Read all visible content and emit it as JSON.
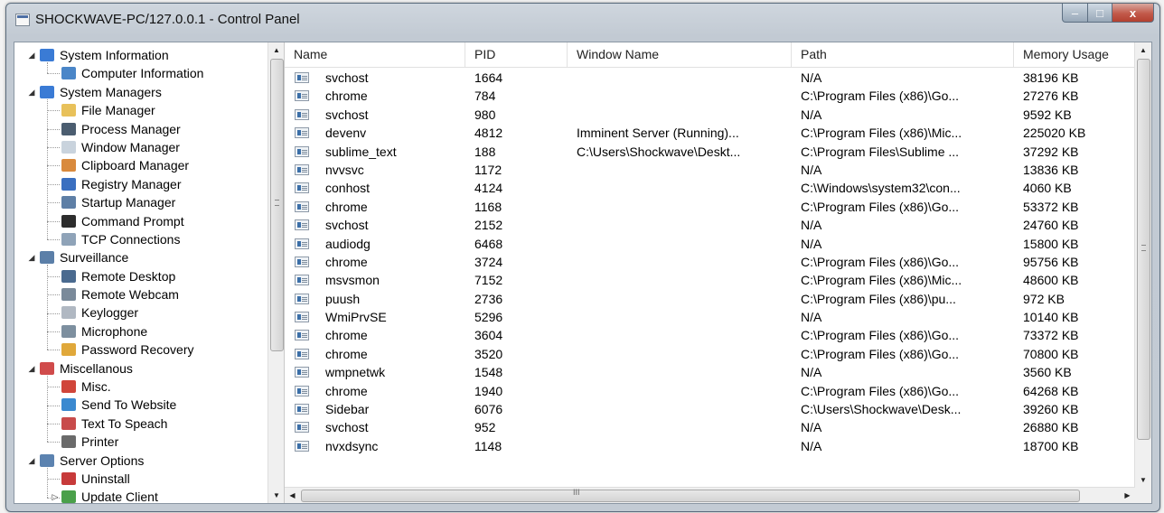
{
  "window": {
    "title": "SHOCKWAVE-PC/127.0.0.1 - Control Panel",
    "buttons": {
      "minimize": "–",
      "maximize": "□",
      "close": "x"
    }
  },
  "tree": {
    "nodes": [
      {
        "label": "System Information",
        "level": 0,
        "icon": "monitor-icon",
        "color": "#3a7bd5",
        "expander": "◢"
      },
      {
        "label": "Computer Information",
        "level": 1,
        "icon": "computer-info-icon",
        "color": "#4a86c8"
      },
      {
        "label": "System Managers",
        "level": 0,
        "icon": "monitor-icon",
        "color": "#3a7bd5",
        "expander": "◢"
      },
      {
        "label": "File Manager",
        "level": 1,
        "icon": "folder-icon",
        "color": "#e8c15a"
      },
      {
        "label": "Process Manager",
        "level": 1,
        "icon": "process-icon",
        "color": "#4b5d70"
      },
      {
        "label": "Window Manager",
        "level": 1,
        "icon": "window-icon",
        "color": "#c9d3dd"
      },
      {
        "label": "Clipboard Manager",
        "level": 1,
        "icon": "clipboard-icon",
        "color": "#d98a3d"
      },
      {
        "label": "Registry Manager",
        "level": 1,
        "icon": "registry-icon",
        "color": "#3a6fc0"
      },
      {
        "label": "Startup Manager",
        "level": 1,
        "icon": "startup-icon",
        "color": "#5e7fa6"
      },
      {
        "label": "Command Prompt",
        "level": 1,
        "icon": "terminal-icon",
        "color": "#2d2d2d"
      },
      {
        "label": "TCP Connections",
        "level": 1,
        "icon": "network-icon",
        "color": "#8fa3b8"
      },
      {
        "label": "Surveillance",
        "level": 0,
        "icon": "eye-icon",
        "color": "#5b7fa8",
        "expander": "◢"
      },
      {
        "label": "Remote Desktop",
        "level": 1,
        "icon": "remote-desktop-icon",
        "color": "#4a6a8f"
      },
      {
        "label": "Remote Webcam",
        "level": 1,
        "icon": "webcam-icon",
        "color": "#7a8a9a"
      },
      {
        "label": "Keylogger",
        "level": 1,
        "icon": "keyboard-icon",
        "color": "#b0b8c2"
      },
      {
        "label": "Microphone",
        "level": 1,
        "icon": "microphone-icon",
        "color": "#7d8f9f"
      },
      {
        "label": "Password Recovery",
        "level": 1,
        "icon": "password-icon",
        "color": "#e0a83a"
      },
      {
        "label": "Miscellanous",
        "level": 0,
        "icon": "misc-icon",
        "color": "#d04b4b",
        "expander": "◢"
      },
      {
        "label": "Misc.",
        "level": 1,
        "icon": "blocks-icon",
        "color": "#d0453a"
      },
      {
        "label": "Send To Website",
        "level": 1,
        "icon": "globe-icon",
        "color": "#3a89d0"
      },
      {
        "label": "Text To Speach",
        "level": 1,
        "icon": "speech-icon",
        "color": "#c84b4b"
      },
      {
        "label": "Printer",
        "level": 1,
        "icon": "printer-icon",
        "color": "#6a6a6a"
      },
      {
        "label": "Server Options",
        "level": 0,
        "icon": "server-icon",
        "color": "#5c83b0",
        "expander": "◢"
      },
      {
        "label": "Uninstall",
        "level": 1,
        "icon": "uninstall-icon",
        "color": "#c73a3a"
      },
      {
        "label": "Update Client",
        "level": 1,
        "icon": "update-icon",
        "color": "#4aa04a",
        "expander": "▷"
      }
    ]
  },
  "table": {
    "columns": [
      "Name",
      "PID",
      "Window Name",
      "Path",
      "Memory Usage"
    ],
    "rows": [
      [
        "svchost",
        "1664",
        "",
        "N/A",
        "38196 KB"
      ],
      [
        "chrome",
        "784",
        "",
        "C:\\Program Files (x86)\\Go...",
        "27276 KB"
      ],
      [
        "svchost",
        "980",
        "",
        "N/A",
        "9592 KB"
      ],
      [
        "devenv",
        "4812",
        "Imminent Server (Running)...",
        "C:\\Program Files (x86)\\Mic...",
        "225020 KB"
      ],
      [
        "sublime_text",
        "188",
        "C:\\Users\\Shockwave\\Deskt...",
        "C:\\Program Files\\Sublime ...",
        "37292 KB"
      ],
      [
        "nvvsvc",
        "1172",
        "",
        "N/A",
        "13836 KB"
      ],
      [
        "conhost",
        "4124",
        "",
        "C:\\Windows\\system32\\con...",
        "4060 KB"
      ],
      [
        "chrome",
        "1168",
        "",
        "C:\\Program Files (x86)\\Go...",
        "53372 KB"
      ],
      [
        "svchost",
        "2152",
        "",
        "N/A",
        "24760 KB"
      ],
      [
        "audiodg",
        "6468",
        "",
        "N/A",
        "15800 KB"
      ],
      [
        "chrome",
        "3724",
        "",
        "C:\\Program Files (x86)\\Go...",
        "95756 KB"
      ],
      [
        "msvsmon",
        "7152",
        "",
        "C:\\Program Files (x86)\\Mic...",
        "48600 KB"
      ],
      [
        "puush",
        "2736",
        "",
        "C:\\Program Files (x86)\\pu...",
        "972 KB"
      ],
      [
        "WmiPrvSE",
        "5296",
        "",
        "N/A",
        "10140 KB"
      ],
      [
        "chrome",
        "3604",
        "",
        "C:\\Program Files (x86)\\Go...",
        "73372 KB"
      ],
      [
        "chrome",
        "3520",
        "",
        "C:\\Program Files (x86)\\Go...",
        "70800 KB"
      ],
      [
        "wmpnetwk",
        "1548",
        "",
        "N/A",
        "3560 KB"
      ],
      [
        "chrome",
        "1940",
        "",
        "C:\\Program Files (x86)\\Go...",
        "64268 KB"
      ],
      [
        "Sidebar",
        "6076",
        "",
        "C:\\Users\\Shockwave\\Desk...",
        "39260 KB"
      ],
      [
        "svchost",
        "952",
        "",
        "N/A",
        "26880 KB"
      ],
      [
        "nvxdsync",
        "1148",
        "",
        "N/A",
        "18700 KB"
      ]
    ]
  },
  "scrollbars": {
    "up": "▲",
    "down": "▼",
    "left": "◀",
    "right": "▶",
    "grip": "≡",
    "hgrip": "III"
  }
}
